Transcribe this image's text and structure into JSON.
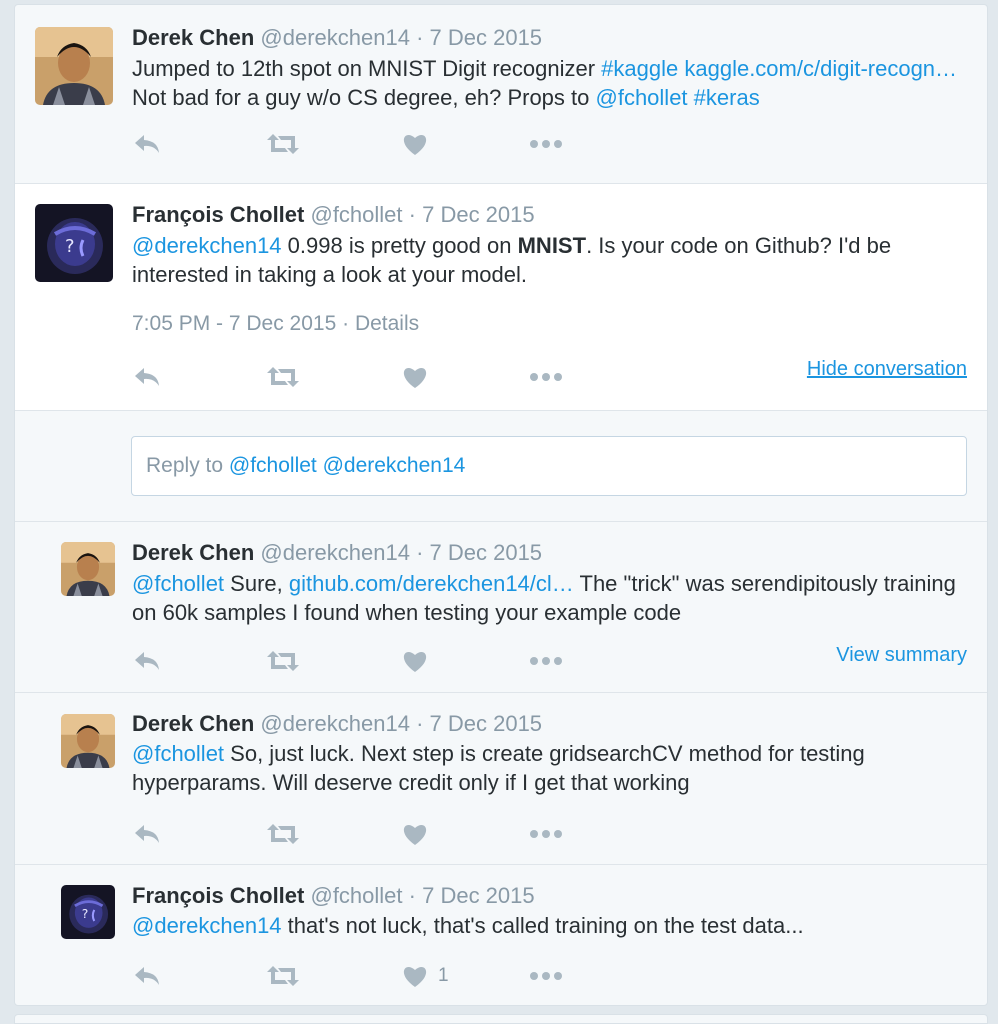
{
  "colors": {
    "link": "#1b95e0",
    "muted": "#8899a6",
    "text": "#292f33",
    "bg": "#f5f8fa"
  },
  "tweets": [
    {
      "name": "Derek Chen",
      "handle": "@derekchen14",
      "sep": " · ",
      "date": "7 Dec 2015",
      "avatar": "derek-avatar",
      "text_parts": [
        {
          "t": "Jumped to 12th spot on MNIST Digit recognizer ",
          "k": "text"
        },
        {
          "t": "#kaggle",
          "k": "link"
        },
        {
          "t": " ",
          "k": "text"
        },
        {
          "t": "kaggle.com/c/digit-recogn…",
          "k": "link"
        },
        {
          "t": " Not bad for a guy w/o CS degree, eh? Props to ",
          "k": "text"
        },
        {
          "t": "@fchollet",
          "k": "link"
        },
        {
          "t": " ",
          "k": "text"
        },
        {
          "t": "#keras",
          "k": "link"
        }
      ],
      "like_count": ""
    },
    {
      "name": "François Chollet",
      "handle": "@fchollet",
      "sep": " · ",
      "date": "7 Dec 2015",
      "avatar": "francois-avatar",
      "text_parts": [
        {
          "t": "@derekchen14",
          "k": "link"
        },
        {
          "t": " 0.998 is pretty good on ",
          "k": "text"
        },
        {
          "t": "MNIST",
          "k": "bold"
        },
        {
          "t": ". Is your code on Github? I'd be interested in taking a look at your model.",
          "k": "text"
        }
      ],
      "meta": "7:05 PM - 7 Dec 2015 · Details",
      "side_link": "Hide conversation",
      "like_count": ""
    },
    {
      "name": "Derek Chen",
      "handle": "@derekchen14",
      "sep": " · ",
      "date": "7 Dec 2015",
      "avatar": "derek-avatar",
      "text_parts": [
        {
          "t": "@fchollet",
          "k": "link"
        },
        {
          "t": " Sure, ",
          "k": "text"
        },
        {
          "t": "github.com/derekchen14/cl…",
          "k": "link"
        },
        {
          "t": " The \"trick\" was serendipitously training on 60k samples I found when testing your example code",
          "k": "text"
        }
      ],
      "side_link": "View summary",
      "like_count": ""
    },
    {
      "name": "Derek Chen",
      "handle": "@derekchen14",
      "sep": " · ",
      "date": "7 Dec 2015",
      "avatar": "derek-avatar",
      "text_parts": [
        {
          "t": "@fchollet",
          "k": "link"
        },
        {
          "t": " So, just luck. Next step is create gridsearchCV method for testing hyperparams. Will deserve credit only if I get that working",
          "k": "text"
        }
      ],
      "like_count": ""
    },
    {
      "name": "François Chollet",
      "handle": "@fchollet",
      "sep": " · ",
      "date": "7 Dec 2015",
      "avatar": "francois-avatar",
      "text_parts": [
        {
          "t": "@derekchen14",
          "k": "link"
        },
        {
          "t": " that's not luck, that's called training on the test data...",
          "k": "text"
        }
      ],
      "like_count": "1"
    }
  ],
  "reply_box": {
    "prefix": "Reply to ",
    "mentions": "@fchollet @derekchen14"
  }
}
